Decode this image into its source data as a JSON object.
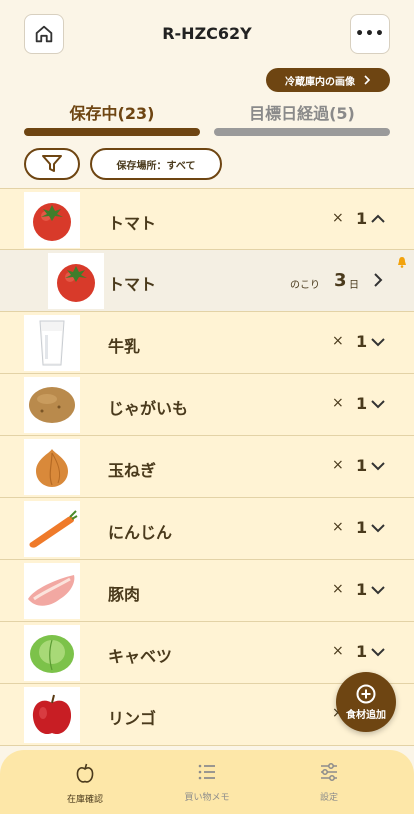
{
  "header": {
    "title": "R-HZC62Y",
    "home_icon": "home-icon",
    "more_icon": "more-icon",
    "more_label": "•••"
  },
  "fridge_button": {
    "label": "冷蔵庫内の画像",
    "icon": "chevron-right-icon"
  },
  "tabs": [
    {
      "label": "保存中(23)",
      "active": true
    },
    {
      "label": "目標日経過(5)",
      "active": false
    }
  ],
  "filter": {
    "icon": "filter-icon",
    "location_label": "保存場所：すべて"
  },
  "items": [
    {
      "name": "トマト",
      "times": "×",
      "qty": "1",
      "expanded": true,
      "image": "tomato"
    },
    {
      "name": "トマト",
      "remain_label": "のこり",
      "days": "3",
      "days_unit": "日",
      "sub": true,
      "image": "tomato",
      "alert_icon": "bell-icon"
    },
    {
      "name": "牛乳",
      "times": "×",
      "qty": "1",
      "image": "milk"
    },
    {
      "name": "じゃがいも",
      "times": "×",
      "qty": "1",
      "image": "potato"
    },
    {
      "name": "玉ねぎ",
      "times": "×",
      "qty": "1",
      "image": "onion"
    },
    {
      "name": "にんじん",
      "times": "×",
      "qty": "1",
      "image": "carrot"
    },
    {
      "name": "豚肉",
      "times": "×",
      "qty": "1",
      "image": "pork"
    },
    {
      "name": "キャベツ",
      "times": "×",
      "qty": "1",
      "image": "cabbage"
    },
    {
      "name": "リンゴ",
      "times": "×",
      "image": "apple"
    }
  ],
  "fab": {
    "label": "食材追加",
    "icon": "plus-circle-icon"
  },
  "bottom_nav": [
    {
      "label": "在庫確認",
      "icon": "apple-icon",
      "active": true
    },
    {
      "label": "買い物メモ",
      "icon": "list-icon",
      "active": false
    },
    {
      "label": "設定",
      "icon": "sliders-icon",
      "active": false
    }
  ],
  "colors": {
    "brand": "#6e4512",
    "row_bg": "#fff3d4",
    "page_bg": "#fbf5e7",
    "nav_bg": "#fde7a8"
  }
}
